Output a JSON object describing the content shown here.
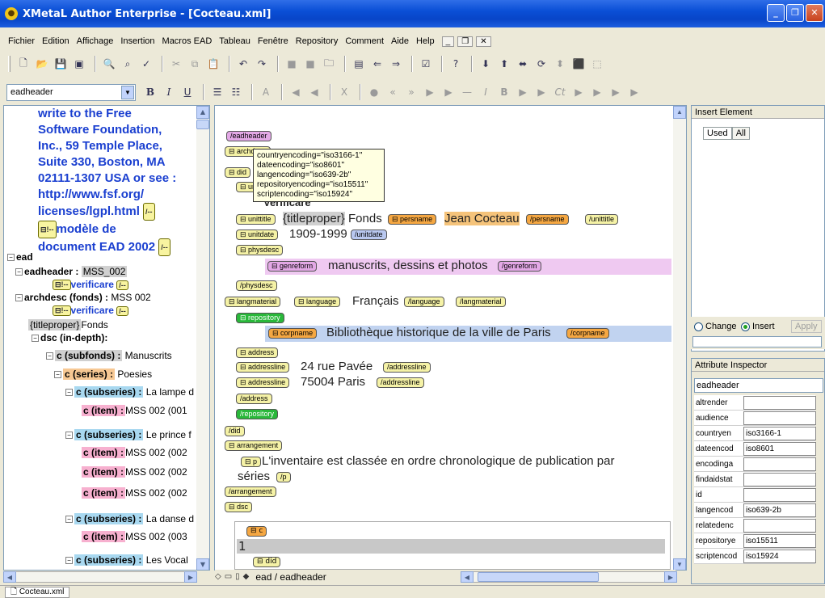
{
  "window": {
    "title": "XMetaL Author Enterprise - [Cocteau.xml]"
  },
  "menu": [
    "Fichier",
    "Edition",
    "Affichage",
    "Insertion",
    "Macros EAD",
    "Tableau",
    "Fenêtre",
    "Repository",
    "Comment",
    "Aide",
    "Help"
  ],
  "toolbar": {
    "element_select": "eadheader"
  },
  "tree": {
    "license_lines": [
      "write to the Free",
      "Software Foundation,",
      "Inc., 59 Temple Place,",
      "Suite 330, Boston, MA",
      "02111-1307 USA or see :",
      "http://www.fsf.org/",
      "licenses/lgpl.html"
    ],
    "comment_lines": [
      "modèle de",
      "document EAD 2002"
    ],
    "ead": "ead",
    "eadheader_label": "eadheader :",
    "eadheader_value": "MSS_002",
    "verificare": "verificare",
    "archdesc_label": "archdesc (fonds) :",
    "archdesc_value": "MSS 002",
    "titleproper_tag": "{titleproper}",
    "titleproper_text": "Fonds",
    "dsc": "dsc (in-depth):",
    "subfonds_label": "c (subfonds) :",
    "subfonds_value": "Manuscrits",
    "series_label": "c (series) :",
    "series_value": "Poesies",
    "subseries1_label": "c (subseries) :",
    "subseries1_value": "La lampe d",
    "item1": "MSS 002 (001",
    "subseries2_value": "Le prince f",
    "item2": "MSS 002 (002",
    "item3": "MSS 002 (002",
    "item4": "MSS 002 (002",
    "subseries3_value": "La danse d",
    "item5": "MSS 002 (003",
    "subseries4_value": "Les Vocal",
    "item_label": "c (item) :"
  },
  "editor": {
    "tooltip": [
      "countryencoding=\"iso3166-1\"",
      "dateencoding=\"iso8601\"",
      "langencoding=\"iso639-2b\"",
      "repositoryencoding=\"iso15511\"",
      "scriptencoding=\"iso15924\""
    ],
    "tags": {
      "eadheader_end": "/eadheader",
      "archdesc": "archdesc",
      "did": "did",
      "unitid": "unitid",
      "unittitle": "unittitle",
      "persname": "persname",
      "persname_end": "/persname",
      "unittitle_end": "/unittitle",
      "unitdate": "unitdate",
      "unitdate_end": "/unitdate",
      "physdesc": "physdesc",
      "genreform": "genreform",
      "genreform_end": "/genreform",
      "physdesc_end": "/physdesc",
      "langmaterial": "langmaterial",
      "language": "language",
      "language_end": "/language",
      "langmaterial_end": "/langmaterial",
      "repository": "repository",
      "corpname": "corpname",
      "corpname_end": "/corpname",
      "address": "address",
      "addressline": "addressline",
      "addressline_end": "/addressline",
      "address_end": "/address",
      "repository_end": "/repository",
      "did_end": "/did",
      "arrangement": "arrangement",
      "p": "p",
      "p_end": "/p",
      "arrangement_end": "/arrangement",
      "dsc": "dsc",
      "c": "c",
      "did2": "did"
    },
    "titleproper": "{titleproper}",
    "fonds": "Fonds",
    "persname_value": "Jean Cocteau",
    "unitid_value": "Verificare",
    "unitdate_value": "1909-1999",
    "genreform_value": "manuscrits, dessins et photos",
    "language_value": "Français",
    "corpname_value": "Bibliothèque historique de la ville de Paris",
    "addressline1": "24 rue Pavée",
    "addressline2": "75004 Paris",
    "arrangement_text1": "L'inventaire est classée en ordre chronologique de publication par",
    "arrangement_text2": "séries",
    "c_number": "1",
    "path": "ead / eadheader"
  },
  "insert_element": {
    "title": "Insert Element",
    "tab_used": "Used",
    "tab_all": "All",
    "change": "Change",
    "insert": "Insert",
    "apply": "Apply"
  },
  "attributes": {
    "title": "Attribute Inspector",
    "element": "eadheader",
    "rows": [
      {
        "name": "altrender",
        "value": ""
      },
      {
        "name": "audience",
        "value": ""
      },
      {
        "name": "countryen",
        "value": "iso3166-1"
      },
      {
        "name": "dateencod",
        "value": "iso8601"
      },
      {
        "name": "encodinga",
        "value": ""
      },
      {
        "name": "findaidstat",
        "value": ""
      },
      {
        "name": "id",
        "value": ""
      },
      {
        "name": "langencod",
        "value": "iso639-2b"
      },
      {
        "name": "relatedenc",
        "value": ""
      },
      {
        "name": "repositorye",
        "value": "iso15511"
      },
      {
        "name": "scriptencod",
        "value": "iso15924"
      }
    ]
  },
  "status": {
    "doc_tab": "Cocteau.xml"
  }
}
